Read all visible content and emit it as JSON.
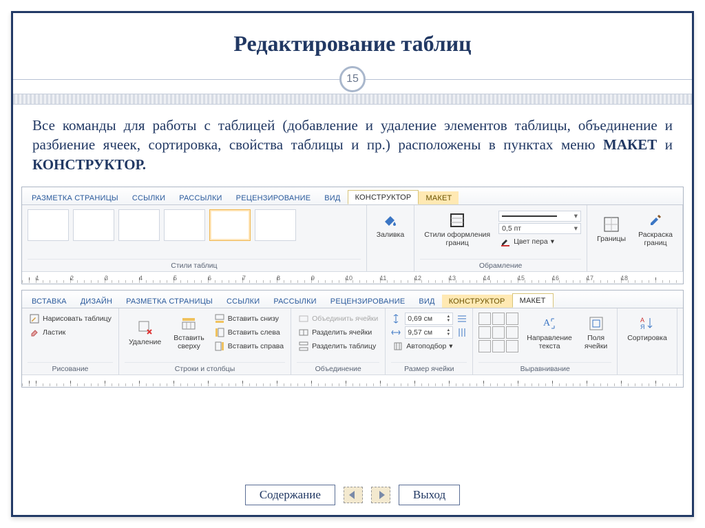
{
  "slide": {
    "title": "Редактирование таблиц",
    "number": "15",
    "desc_part1": "Все команды для работы с таблицей (добавление и удаление элементов таблицы, объединение и разбиение ячеек, сортировка, свойства таблицы и пр.) расположены в пунктах меню ",
    "desc_bold1": "МАКЕТ",
    "desc_and": " и ",
    "desc_bold2": "КОНСТРУКТОР."
  },
  "nav": {
    "contents": "Содержание",
    "exit": "Выход"
  },
  "ribbon1": {
    "tabs": [
      "РАЗМЕТКА СТРАНИЦЫ",
      "ССЫЛКИ",
      "РАССЫЛКИ",
      "РЕЦЕНЗИРОВАНИЕ",
      "ВИД"
    ],
    "ctx_tabs": [
      "КОНСТРУКТОР",
      "МАКЕТ"
    ],
    "active_ctx": "КОНСТРУКТОР",
    "groups": {
      "styles": "Стили таблиц",
      "fill": "Заливка",
      "border_styles": "Стили оформления\nграниц",
      "weight": "0,5 пт",
      "pen_color": "Цвет пера",
      "framing": "Обрамление",
      "borders": "Границы",
      "painter": "Раскраска\nграниц"
    },
    "ruler": [
      "1",
      "2",
      "3",
      "4",
      "5",
      "6",
      "7",
      "8",
      "9",
      "10",
      "11",
      "12",
      "13",
      "14",
      "15",
      "16",
      "17",
      "18"
    ]
  },
  "ribbon2": {
    "tabs": [
      "ВСТАВКА",
      "ДИЗАЙН",
      "РАЗМЕТКА СТРАНИЦЫ",
      "ССЫЛКИ",
      "РАССЫЛКИ",
      "РЕЦЕНЗИРОВАНИЕ",
      "ВИД"
    ],
    "ctx_tabs": [
      "КОНСТРУКТОР",
      "МАКЕТ"
    ],
    "active_ctx": "МАКЕТ",
    "drawing": {
      "draw": "Нарисовать таблицу",
      "eraser": "Ластик",
      "label": "Рисование"
    },
    "rowscols": {
      "delete": "Удаление",
      "insert_above": "Вставить\nсверху",
      "below": "Вставить снизу",
      "left": "Вставить слева",
      "right": "Вставить справа",
      "label": "Строки и столбцы"
    },
    "merge": {
      "merge": "Объединить ячейки",
      "split": "Разделить ячейки",
      "split_table": "Разделить таблицу",
      "label": "Объединение"
    },
    "cellsize": {
      "h": "0,69 см",
      "w": "9,57 см",
      "autofit": "Автоподбор",
      "label": "Размер ячейки"
    },
    "align": {
      "dir": "Направление\nтекста",
      "margins": "Поля\nячейки",
      "label": "Выравнивание"
    },
    "data": {
      "sort": "Сортировка"
    }
  }
}
